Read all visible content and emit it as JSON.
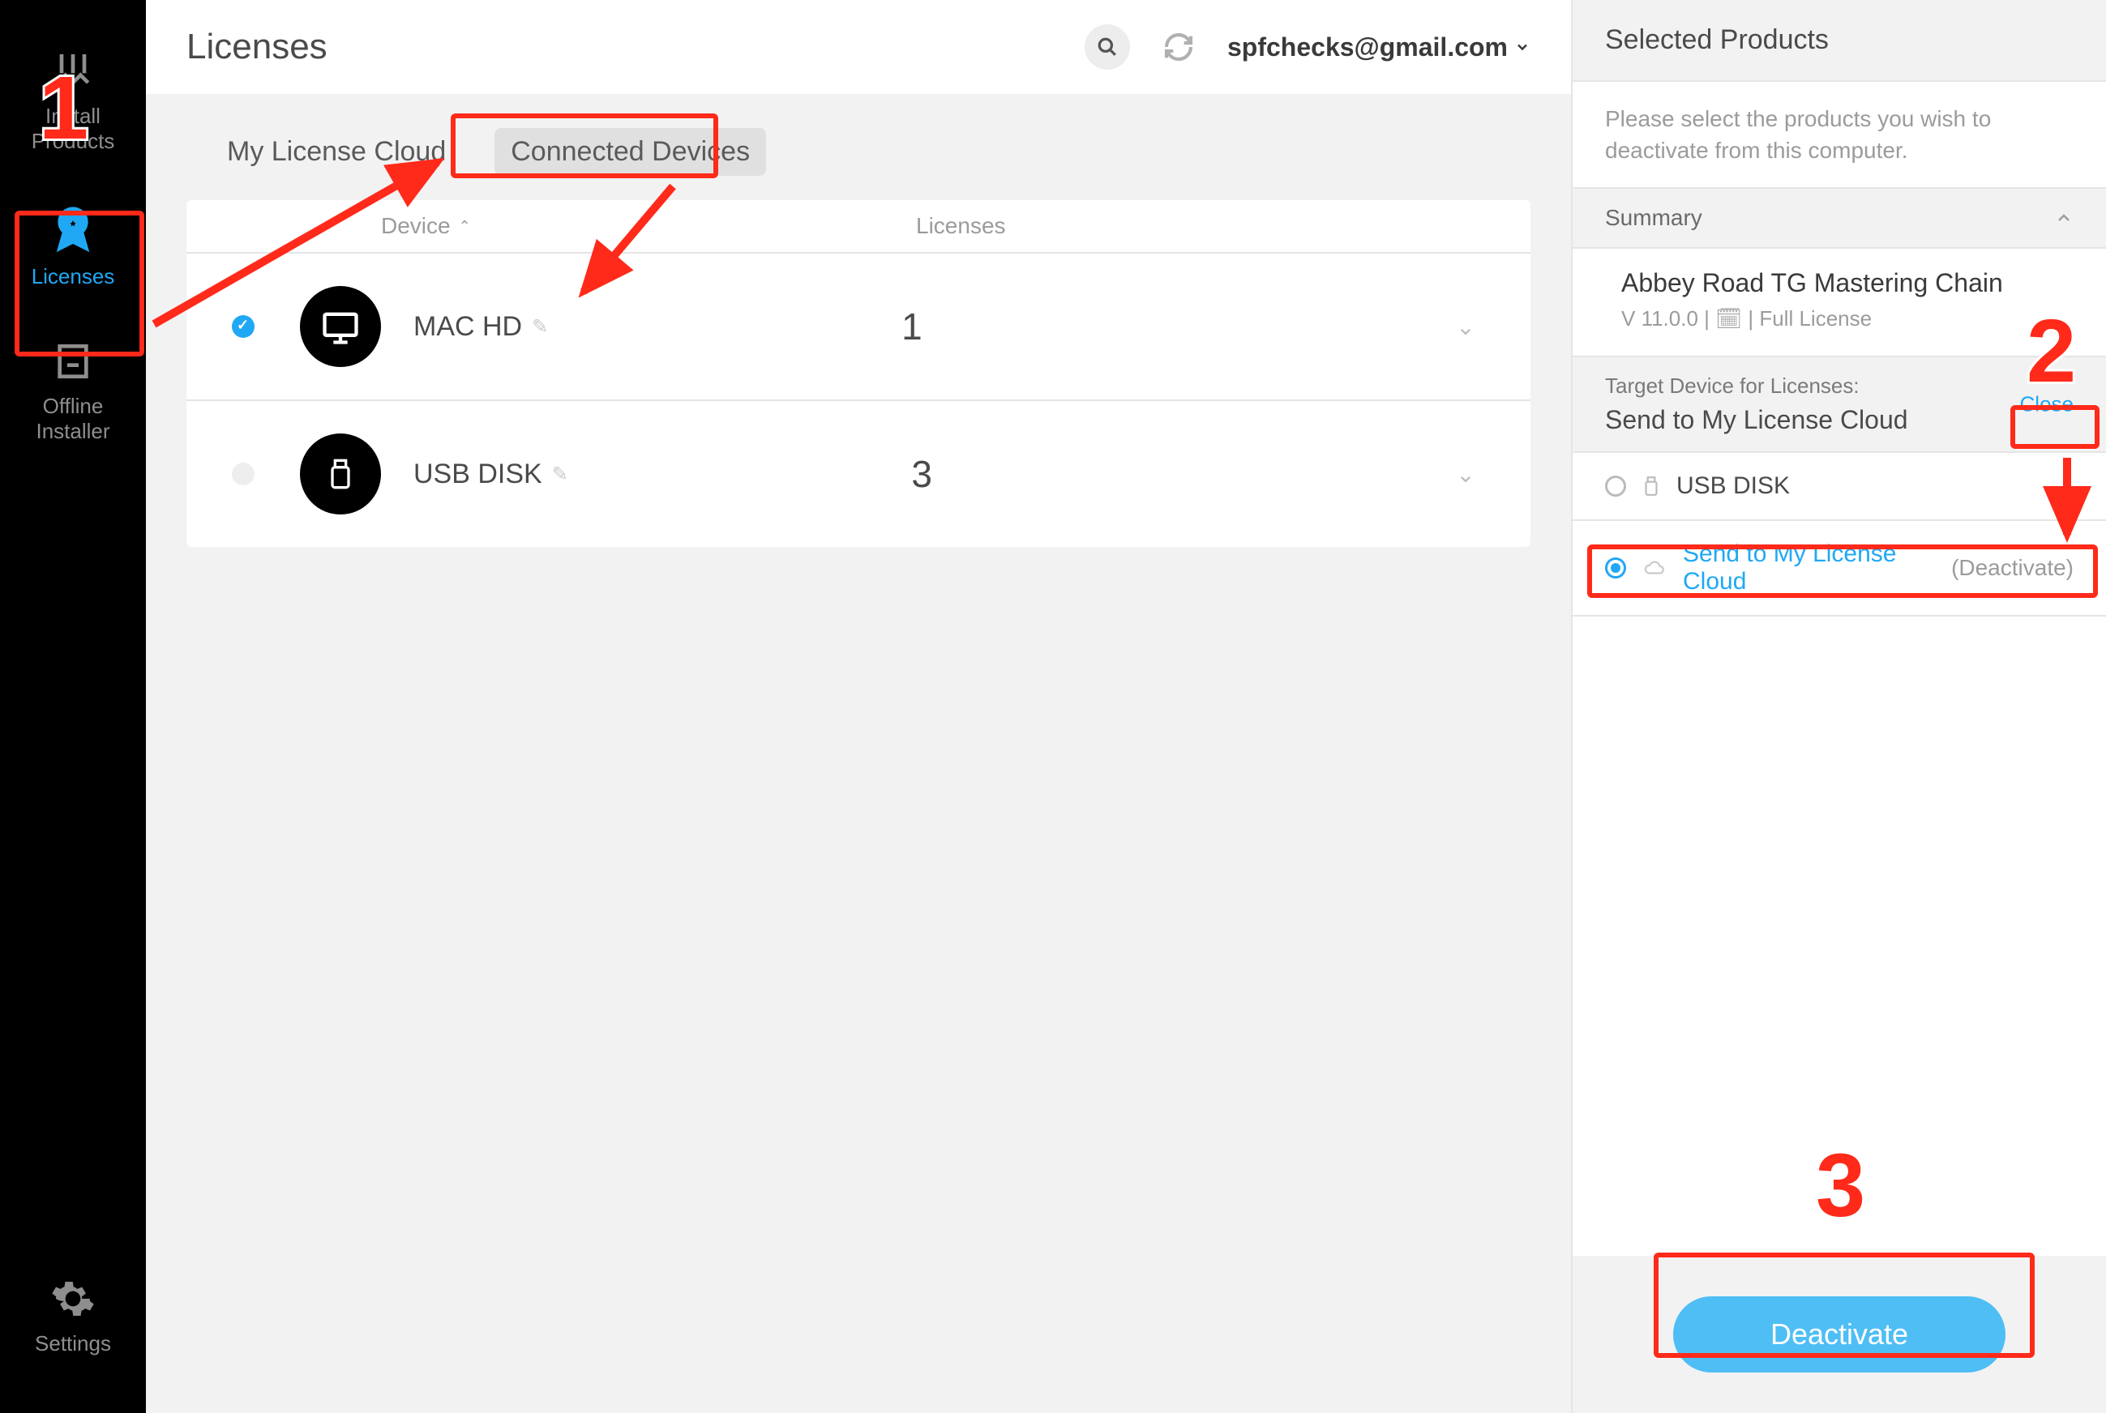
{
  "sidebar": {
    "install": "Install\nProducts",
    "licenses": "Licenses",
    "offline": "Offline\nInstaller",
    "settings": "Settings"
  },
  "header": {
    "title": "Licenses",
    "account_email": "spfchecks@gmail.com"
  },
  "tabs": {
    "cloud": "My License Cloud",
    "devices": "Connected Devices"
  },
  "table": {
    "col_device": "Device",
    "col_licenses": "Licenses",
    "rows": [
      {
        "name": "MAC HD",
        "count": "1",
        "selected": true,
        "kind": "computer"
      },
      {
        "name": "USB DISK",
        "count": "3",
        "selected": false,
        "kind": "usb"
      }
    ]
  },
  "panel": {
    "title": "Selected Products",
    "hint": "Please select the products you wish to deactivate from this computer.",
    "summary_label": "Summary",
    "product": {
      "name": "Abbey Road TG Mastering Chain",
      "meta": "V 11.0.0 | 🗓 | Full License"
    },
    "target_label": "Target Device for Licenses:",
    "target_value": "Send to My License Cloud",
    "close": "Close",
    "options": {
      "usb": "USB DISK",
      "cloud": "Send to My License Cloud",
      "cloud_suffix": "(Deactivate)"
    },
    "deactivate": "Deactivate"
  },
  "annotations": {
    "n1": "1",
    "n2": "2",
    "n3": "3"
  }
}
